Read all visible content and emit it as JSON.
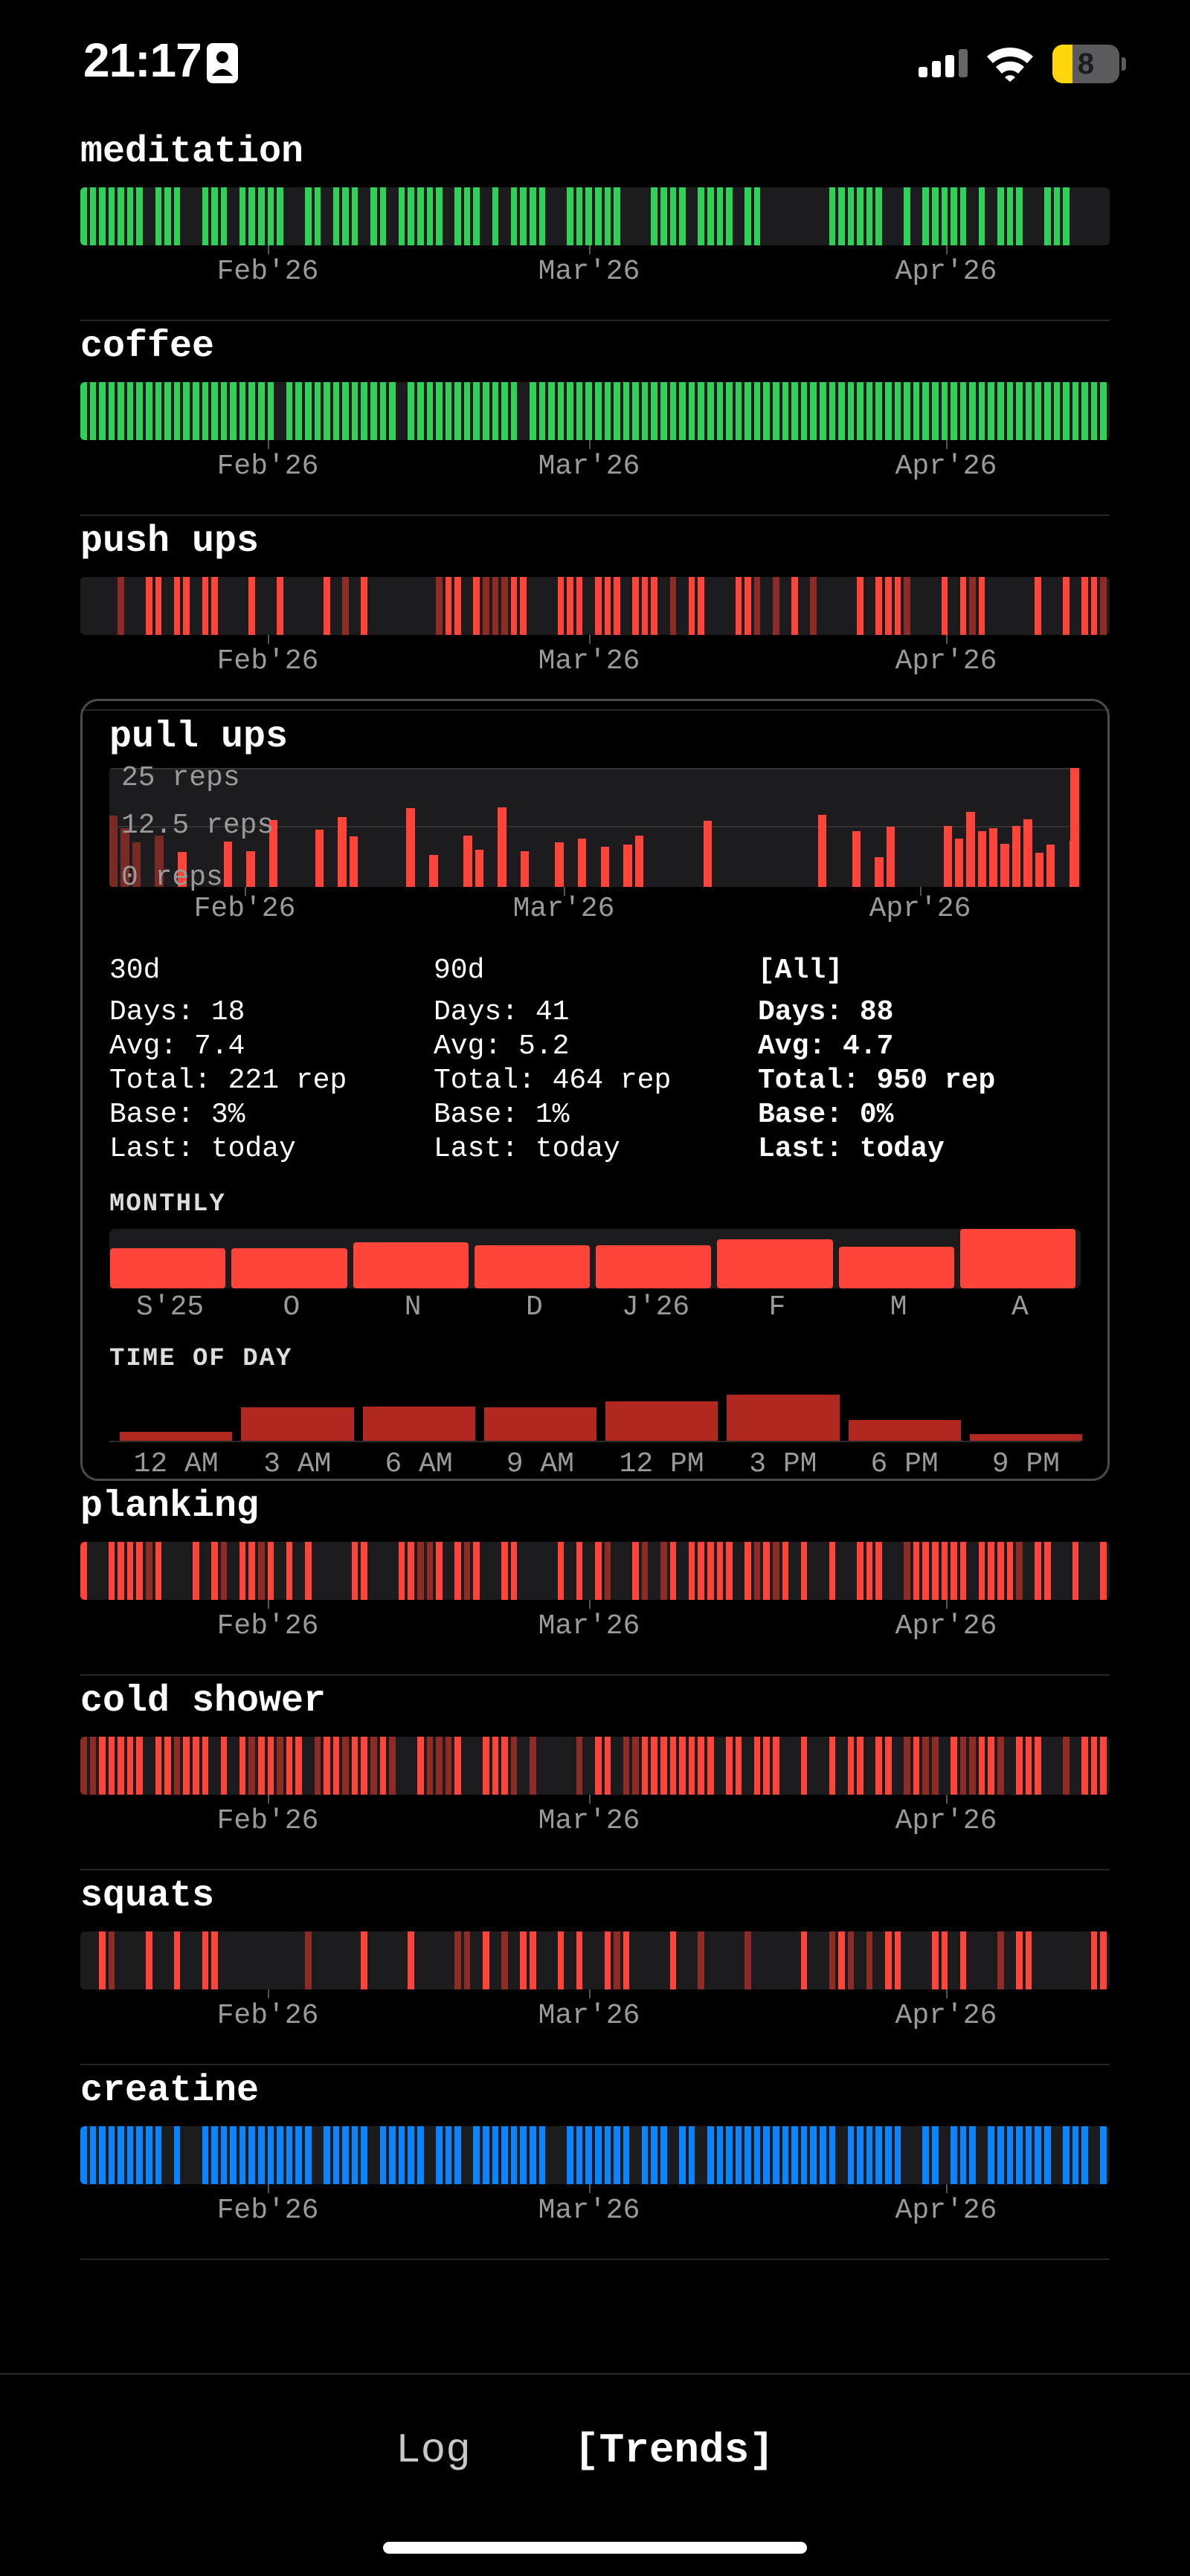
{
  "status_bar": {
    "time": "21:17",
    "battery_level": "8",
    "battery_fraction": 0.3,
    "icons": [
      "contact-icon",
      "signal-icon",
      "wifi-icon",
      "battery-icon"
    ]
  },
  "colors": {
    "green": "#30d158",
    "red": "#ff453a",
    "red_dim": "#8e2b24",
    "blue": "#0a84ff",
    "track": "#1c1c1e"
  },
  "month_axis": [
    "Feb'26",
    "Mar'26",
    "Apr'26"
  ],
  "habits": [
    {
      "title": "meditation",
      "color": "green"
    },
    {
      "title": "coffee",
      "color": "green"
    },
    {
      "title": "push ups",
      "color": "red"
    },
    {
      "title": "pull ups",
      "color": "red",
      "expanded": true
    },
    {
      "title": "planking",
      "color": "red"
    },
    {
      "title": "cold shower",
      "color": "red"
    },
    {
      "title": "squats",
      "color": "red"
    },
    {
      "title": "creatine",
      "color": "blue"
    }
  ],
  "pull_ups": {
    "title": "pull ups",
    "y_ticks": [
      "25 reps",
      "12.5 reps",
      "0 reps"
    ],
    "months": [
      "Feb'26",
      "Mar'26",
      "Apr'26"
    ],
    "stats": [
      {
        "head": "30d",
        "days": "Days: 18",
        "avg": "Avg: 7.4",
        "total": "Total: 221 rep",
        "base": "Base: 3%",
        "last": "Last: today"
      },
      {
        "head": "90d",
        "days": "Days: 41",
        "avg": "Avg: 5.2",
        "total": "Total: 464 rep",
        "base": "Base: 1%",
        "last": "Last: today"
      },
      {
        "head": "[All]",
        "days": "Days: 88",
        "avg": "Avg: 4.7",
        "total": "Total: 950 rep",
        "base": "Base: 0%",
        "last": "Last: today"
      }
    ],
    "monthly_label": "MONTHLY",
    "monthly": {
      "labels": [
        "S'25",
        "O",
        "N",
        "D",
        "J'26",
        "F",
        "M",
        "A"
      ],
      "values": [
        0.68,
        0.68,
        0.78,
        0.73,
        0.73,
        0.83,
        0.7,
        1.0
      ]
    },
    "time_of_day_label": "TIME OF DAY",
    "time_of_day": {
      "labels": [
        "12 AM",
        "3 AM",
        "6 AM",
        "9 AM",
        "12 PM",
        "3 PM",
        "6 PM",
        "9 PM"
      ],
      "values": [
        0.2,
        0.72,
        0.74,
        0.72,
        0.86,
        1.0,
        0.45,
        0.14
      ]
    }
  },
  "tabs": {
    "log": "Log",
    "trends": "[Trends]"
  }
}
